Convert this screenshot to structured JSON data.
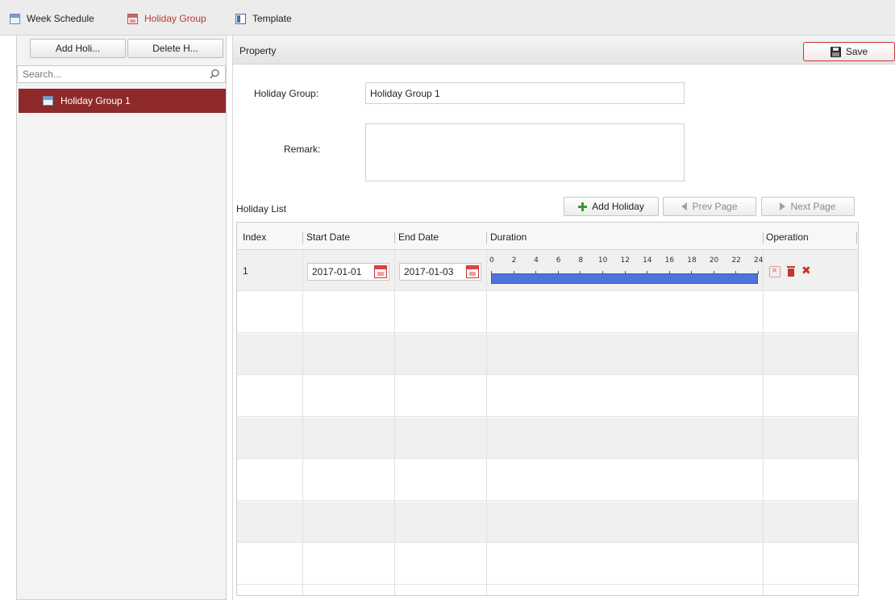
{
  "tabs": [
    {
      "label": "Week Schedule",
      "active": false,
      "icon": "calendar-icon"
    },
    {
      "label": "Holiday Group",
      "active": true,
      "icon": "holiday-calendar-icon"
    },
    {
      "label": "Template",
      "active": false,
      "icon": "template-icon"
    }
  ],
  "left": {
    "add_button": "Add Holi...",
    "delete_button": "Delete H...",
    "search_placeholder": "Search...",
    "tree_items": [
      {
        "label": "Holiday Group 1",
        "selected": true,
        "icon": "holiday-group-icon"
      }
    ]
  },
  "property": {
    "title": "Property",
    "save_label": "Save",
    "holiday_group_label": "Holiday Group:",
    "holiday_group_value": "Holiday Group 1",
    "remark_label": "Remark:",
    "remark_value": ""
  },
  "holiday_list": {
    "title": "Holiday List",
    "add_label": "Add Holiday",
    "prev_label": "Prev Page",
    "next_label": "Next Page",
    "columns": {
      "index": "Index",
      "start": "Start Date",
      "end": "End Date",
      "duration": "Duration",
      "operation": "Operation"
    },
    "rows": [
      {
        "index": "1",
        "start": "2017-01-01",
        "end": "2017-01-03",
        "duration_hours": 24
      }
    ],
    "timeline_ticks": [
      "0",
      "2",
      "4",
      "6",
      "8",
      "10",
      "12",
      "14",
      "16",
      "18",
      "20",
      "22",
      "24"
    ]
  },
  "colors": {
    "accent": "#8e2a2a",
    "active_tab": "#c0392b",
    "timeline_fill": "#4f73dc"
  }
}
